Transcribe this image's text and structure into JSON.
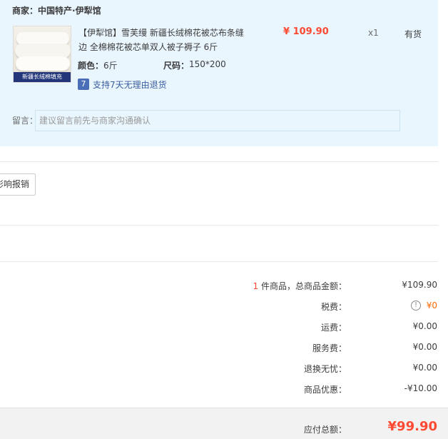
{
  "shop": {
    "label": "商家：",
    "name": "中国特产·伊犁馆"
  },
  "item": {
    "image_caption": "新疆长绒棉填充",
    "title": "【伊犁馆】雪芙缦 新疆长绒棉花被芯布条缝边 全棉棉花被芯单双人被子褥子 6斤",
    "price": "¥ 109.90",
    "quantity": "x1",
    "stock": "有货",
    "color_label": "颜色：",
    "color_value": "6斤",
    "size_label": "尺码：",
    "size_value": "150*200",
    "promise_icon": "7",
    "promise_text": "支持7天无理由退货"
  },
  "memo": {
    "label": "留言：",
    "placeholder": "建议留言前先与商家沟通确认"
  },
  "partial_button": "影响报销",
  "summary": {
    "count": "1",
    "items_label": " 件商品，总商品金额：",
    "items_value": "¥109.90",
    "tax_label": "税费：",
    "tax_value": "¥0",
    "shipping_label": "运费：",
    "shipping_value": "¥0.00",
    "service_label": "服务费：",
    "service_value": "¥0.00",
    "return_label": "退换无忧：",
    "return_value": "¥0.00",
    "discount_label": "商品优惠：",
    "discount_value": "-¥10.00",
    "total_label": "应付总额：",
    "total_value": "¥99.90"
  },
  "colors": {
    "accent": "#ff4a33",
    "panel_bg": "#eaf6fe",
    "link": "#3c5ea0"
  }
}
